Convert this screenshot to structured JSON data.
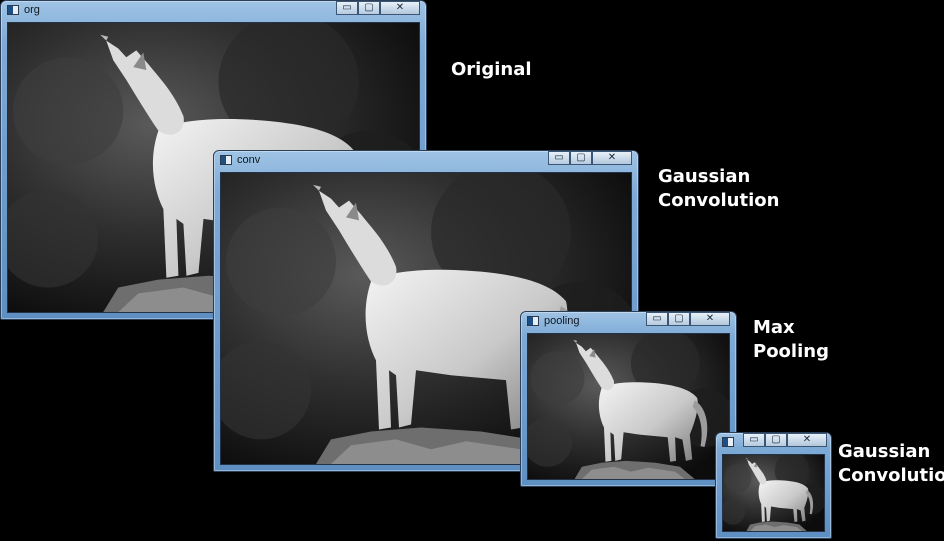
{
  "windows": [
    {
      "title": "org"
    },
    {
      "title": "conv"
    },
    {
      "title": "pooling"
    },
    {
      "title": ""
    }
  ],
  "controls": {
    "minimize": "▭",
    "maximize": "▢",
    "close": "✕"
  },
  "captions": {
    "original": "Original",
    "gaussian1_line1": "Gaussian",
    "gaussian1_line2": "Convolution",
    "max_line1": "Max",
    "max_line2": "Pooling",
    "gaussian2_line1": "Gaussian",
    "gaussian2_line2": "Convolution"
  }
}
